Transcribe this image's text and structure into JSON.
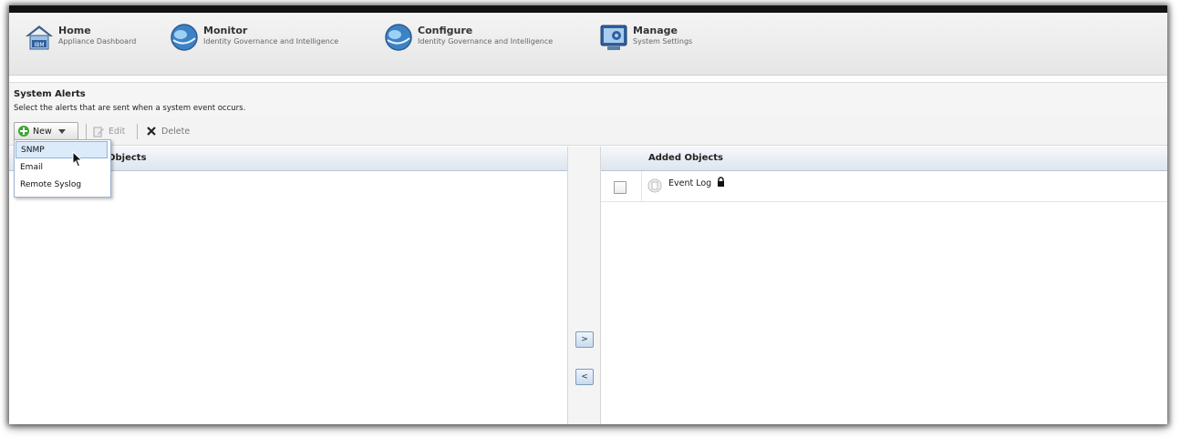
{
  "nav": {
    "items": [
      {
        "title": "Home",
        "subtitle": "Appliance Dashboard",
        "icon": "home-icon"
      },
      {
        "title": "Monitor",
        "subtitle": "Identity Governance and Intelligence",
        "icon": "globe-icon"
      },
      {
        "title": "Configure",
        "subtitle": "Identity Governance and Intelligence",
        "icon": "globe-icon"
      },
      {
        "title": "Manage",
        "subtitle": "System Settings",
        "icon": "settings-icon"
      }
    ]
  },
  "section": {
    "title": "System Alerts",
    "description": "Select the alerts that are sent when a system event occurs."
  },
  "toolbar": {
    "new_label": "New",
    "edit_label": "Edit",
    "delete_label": "Delete"
  },
  "dropdown": {
    "items": [
      "SNMP",
      "Email",
      "Remote Syslog"
    ],
    "highlighted": "SNMP"
  },
  "left_panel": {
    "header": "Objects"
  },
  "transfer": {
    "add_label": ">",
    "remove_label": "<"
  },
  "right_panel": {
    "header": "Added Objects",
    "rows": [
      {
        "label": "Event Log",
        "locked": true
      }
    ]
  },
  "colors": {
    "accent": "#2f5f9e",
    "add_green": "#3fa535",
    "delete_dark": "#222222"
  }
}
